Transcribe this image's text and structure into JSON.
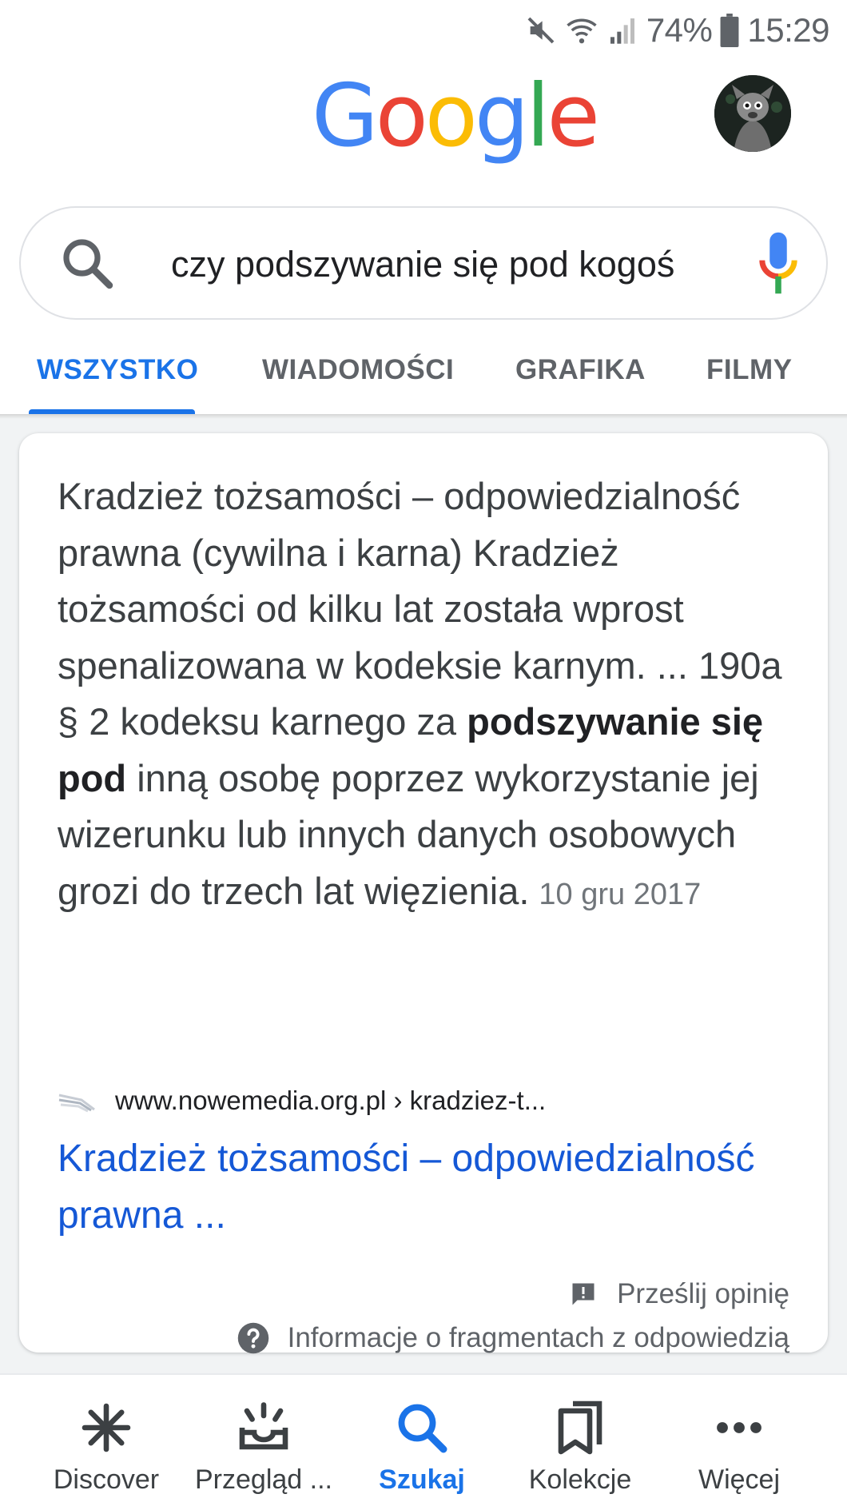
{
  "status_bar": {
    "battery": "74%",
    "time": "15:29",
    "icons": [
      "mute-icon",
      "wifi-icon",
      "signal-icon",
      "battery-icon"
    ]
  },
  "header": {
    "logo": "Google",
    "logo_colors": [
      "#4285F4",
      "#EA4335",
      "#FBBC05",
      "#4285F4",
      "#34A853",
      "#EA4335"
    ]
  },
  "search": {
    "query": "czy podszywanie się pod kogoś"
  },
  "tabs": [
    {
      "label": "WSZYSTKO",
      "active": true
    },
    {
      "label": "WIADOMOŚCI",
      "active": false
    },
    {
      "label": "GRAFIKA",
      "active": false
    },
    {
      "label": "FILMY",
      "active": false
    }
  ],
  "snippet": {
    "text_before": "Kradzież tożsamości – odpowiedzialność prawna (cywilna i karna) Kradzież tożsamości od kilku lat została wprost spenalizowana w kodeksie karnym. ... 190a § 2 kodeksu karnego za ",
    "text_bold": "podszywanie się pod",
    "text_after": " inną osobę poprzez wykorzystanie jej wizerunku lub innych danych osobowych grozi do trzech lat więzienia.",
    "date": "10 gru 2017"
  },
  "result": {
    "url": "www.nowemedia.org.pl › kradziez-t...",
    "title": "Kradzież tożsamości – odpowiedzialność prawna ..."
  },
  "footer_links": {
    "feedback": "Prześlij opinię",
    "about": "Informacje o fragmentach z odpowiedzią"
  },
  "bottom_nav": [
    {
      "label": "Discover",
      "icon": "discover-icon",
      "active": false
    },
    {
      "label": "Przegląd ...",
      "icon": "updates-icon",
      "active": false
    },
    {
      "label": "Szukaj",
      "icon": "search-icon",
      "active": true
    },
    {
      "label": "Kolekcje",
      "icon": "collections-icon",
      "active": false
    },
    {
      "label": "Więcej",
      "icon": "more-icon",
      "active": false
    }
  ],
  "colors": {
    "accent": "#1a73e8",
    "link": "#1558d6",
    "text": "#3c4043",
    "muted": "#5f6368"
  }
}
